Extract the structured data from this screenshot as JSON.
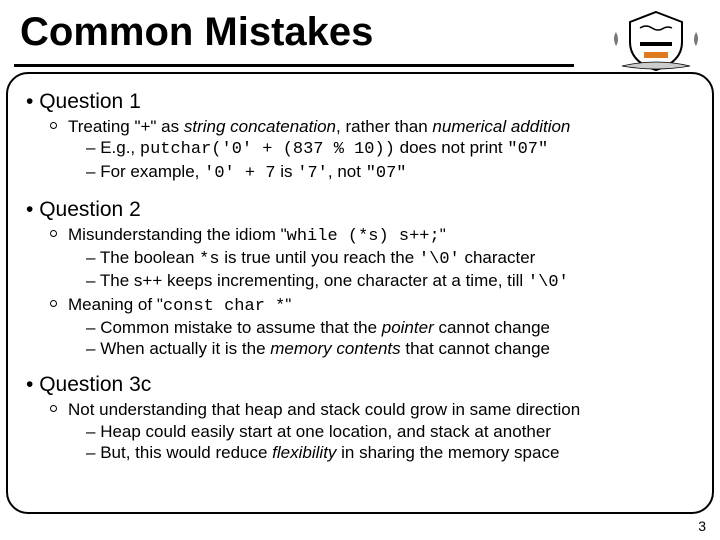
{
  "title": "Common Mistakes",
  "page_number": "3",
  "q1": {
    "heading": "Question 1",
    "b1": {
      "p1": "Treating \"+\" as ",
      "p2": "string concatenation",
      "p3": ", rather than ",
      "p4": "numerical addition"
    },
    "d1": {
      "p1": "E.g., ",
      "p2": "putchar('0' + (837 % 10))",
      "p3": " does not print ",
      "p4": "\"07\""
    },
    "d2": {
      "p1": "For example, ",
      "p2": "'0' + 7",
      "p3": " is ",
      "p4": "'7'",
      "p5": ", not ",
      "p6": "\"07\""
    }
  },
  "q2": {
    "heading": "Question 2",
    "b1": {
      "p1": "Misunderstanding the idiom \"",
      "p2": "while (*s) s++;",
      "p3": "\""
    },
    "d1": {
      "p1": "The boolean ",
      "p2": "*s",
      "p3": " is true until you reach the ",
      "p4": "'\\0'",
      "p5": " character"
    },
    "d2": {
      "p1": "The s++ keeps incrementing, one character at a time, till ",
      "p2": "'\\0'"
    },
    "b2": {
      "p1": "Meaning of \"",
      "p2": "const char *",
      "p3": "\""
    },
    "d3": {
      "p1": "Common mistake to assume that the ",
      "p2": "pointer",
      "p3": " cannot change"
    },
    "d4": {
      "p1": "When actually it is the ",
      "p2": "memory contents",
      "p3": " that cannot change"
    }
  },
  "q3": {
    "heading": "Question 3c",
    "b1": {
      "p1": "Not understanding that heap and stack could grow in same direction"
    },
    "d1": {
      "p1": "Heap could easily start at one location, and stack at another"
    },
    "d2": {
      "p1": "But, this would reduce ",
      "p2": "flexibility",
      "p3": " in sharing the memory space"
    }
  }
}
